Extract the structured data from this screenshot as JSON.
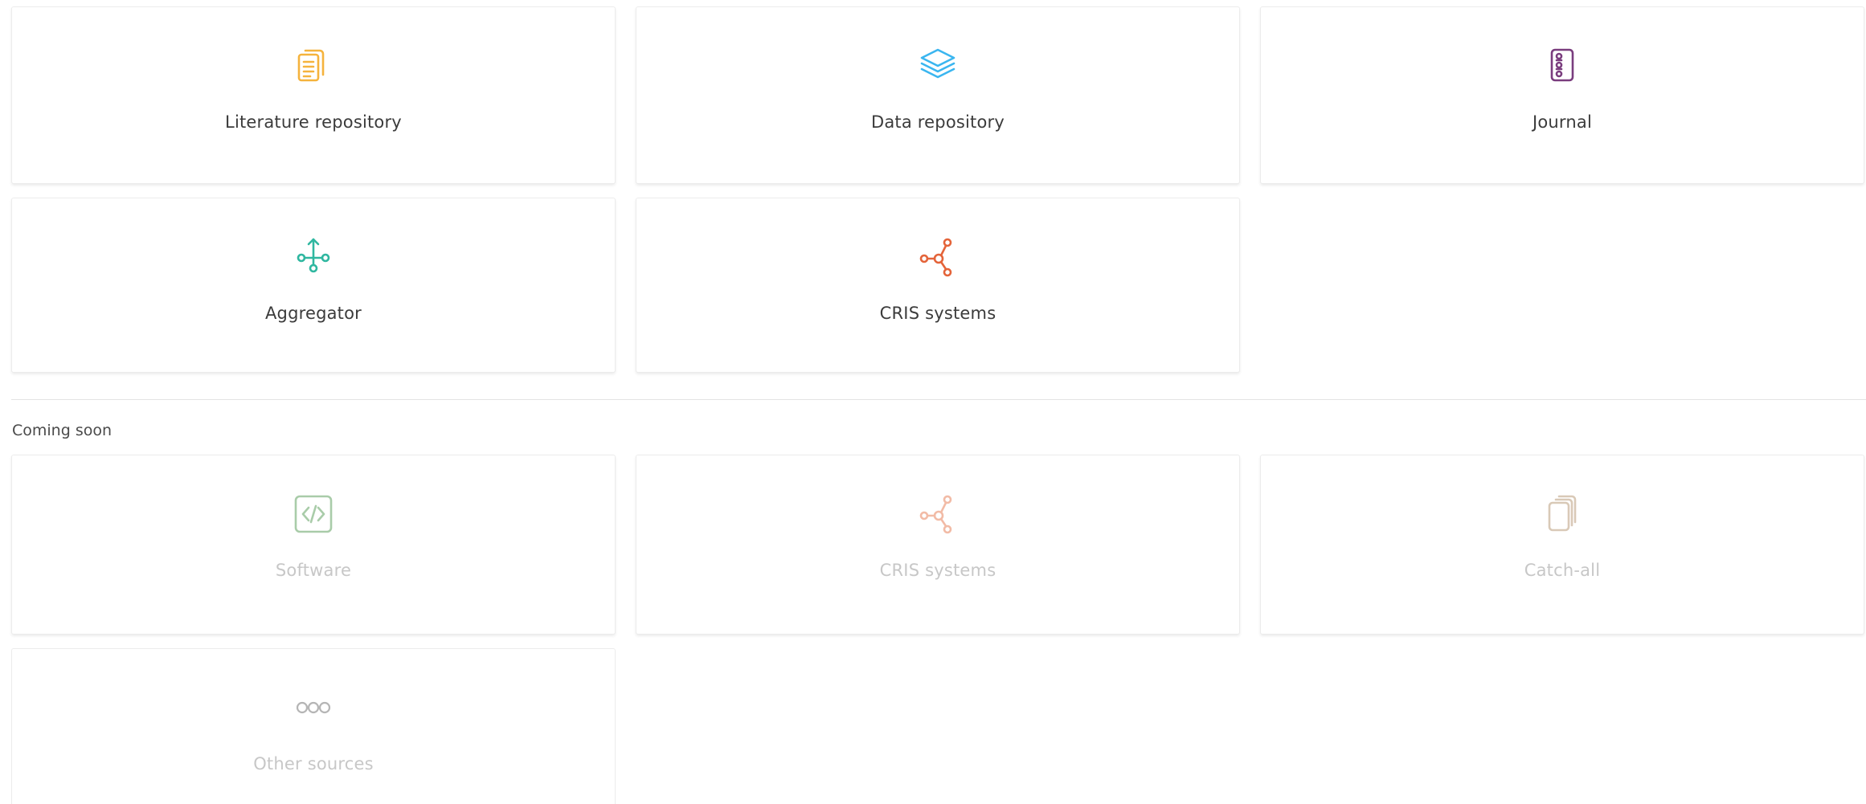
{
  "active_sources": [
    {
      "label": "Literature repository",
      "icon": "documents-icon",
      "color": "#F5B33D"
    },
    {
      "label": "Data repository",
      "icon": "layers-icon",
      "color": "#3BB6F0"
    },
    {
      "label": "Journal",
      "icon": "journal-icon",
      "color": "#7A3D7E"
    },
    {
      "label": "Aggregator",
      "icon": "aggregator-icon",
      "color": "#2FB7A0"
    },
    {
      "label": "CRIS systems",
      "icon": "network-icon",
      "color": "#E4643A"
    }
  ],
  "coming_soon": {
    "title": "Coming soon",
    "items": [
      {
        "label": "Software",
        "icon": "code-icon",
        "color": "#A9CCA9"
      },
      {
        "label": "CRIS systems",
        "icon": "network-icon",
        "color": "#F2BBA6"
      },
      {
        "label": "Catch-all",
        "icon": "stack-icon",
        "color": "#D9C9B7"
      },
      {
        "label": "Other sources",
        "icon": "more-icon",
        "color": "#B5B5B5"
      }
    ]
  }
}
